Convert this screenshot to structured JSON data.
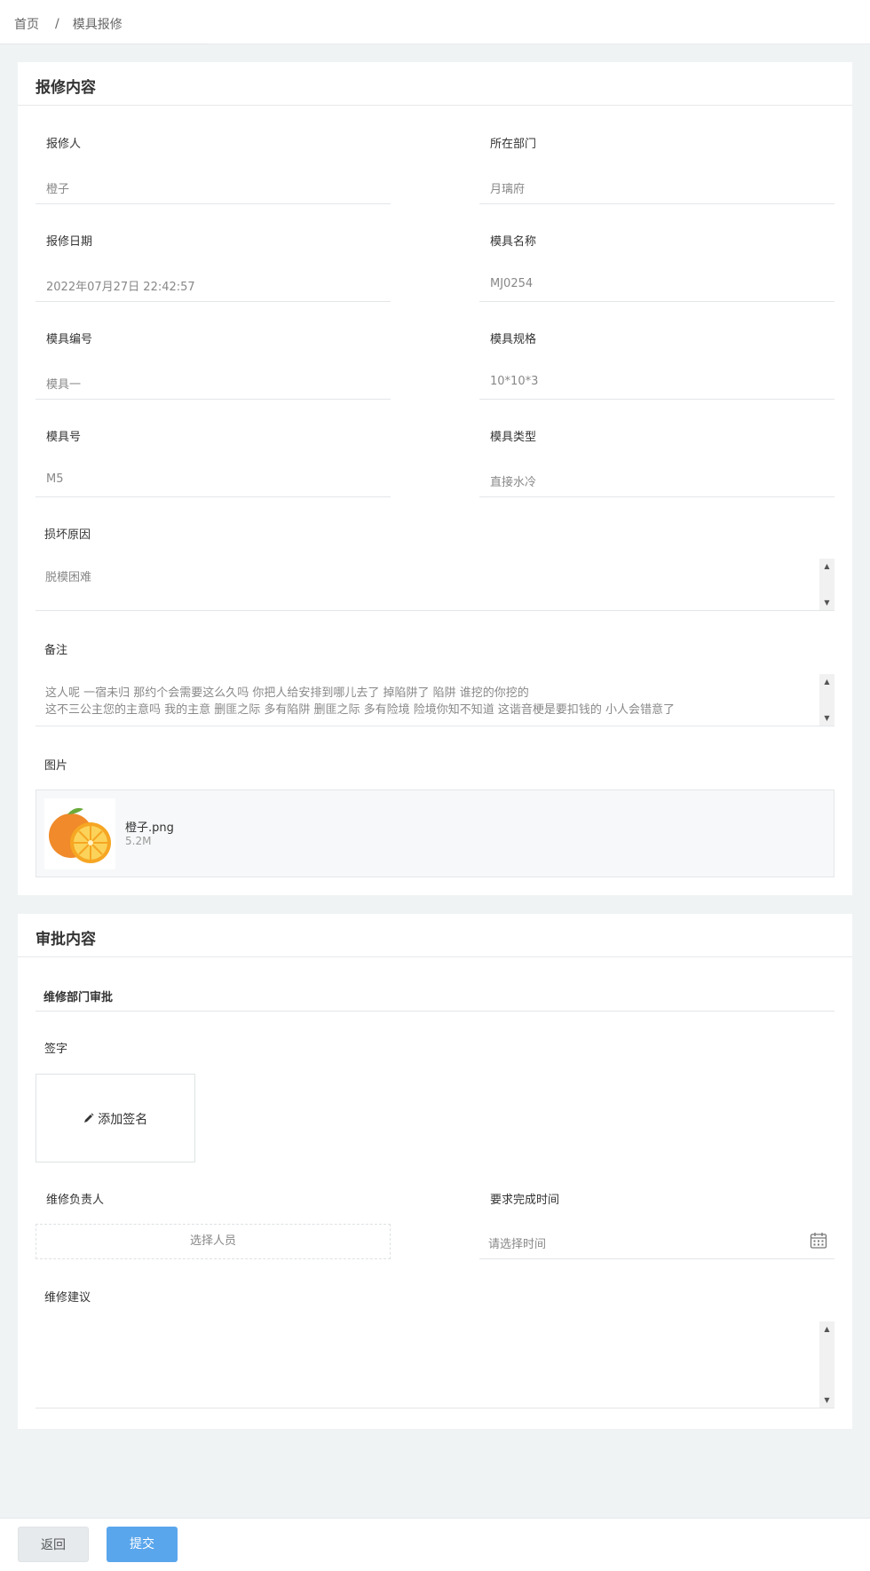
{
  "breadcrumb": {
    "home": "首页",
    "separator": "/",
    "current": "模具报修"
  },
  "repair": {
    "title": "报修内容",
    "fields": {
      "reporter": {
        "label": "报修人",
        "value": "橙子"
      },
      "department": {
        "label": "所在部门",
        "value": "月璃府"
      },
      "date": {
        "label": "报修日期",
        "value": "2022年07月27日 22:42:57"
      },
      "mold_name": {
        "label": "模具名称",
        "value": "MJ0254"
      },
      "mold_code": {
        "label": "模具编号",
        "value": "模具一"
      },
      "mold_spec": {
        "label": "模具规格",
        "value": "10*10*3"
      },
      "mold_no": {
        "label": "模具号",
        "value": "M5"
      },
      "mold_type": {
        "label": "模具类型",
        "value": "直接水冷"
      }
    },
    "damage": {
      "label": "损坏原因",
      "value": "脱模困难"
    },
    "remark": {
      "label": "备注",
      "line1": "这人呢 一宿未归 那约个会需要这么久吗 你把人给安排到哪儿去了 掉陷阱了 陷阱 谁挖的你挖的",
      "line2": "这不三公主您的主意吗 我的主意 删匪之际 多有陷阱 删匪之际 多有险境 险境你知不知道 这谐音梗是要扣钱的 小人会错意了"
    },
    "image": {
      "label": "图片",
      "file_name": "橙子.png",
      "file_size": "5.2M"
    }
  },
  "approval": {
    "title": "审批内容",
    "section": "维修部门审批",
    "signature": {
      "label": "签字",
      "button": "添加签名",
      "icon": "pencil-icon"
    },
    "person": {
      "label": "维修负责人",
      "placeholder": "选择人员"
    },
    "deadline": {
      "label": "要求完成时间",
      "placeholder": "请选择时间",
      "icon": "calendar-icon"
    },
    "advice": {
      "label": "维修建议",
      "value": ""
    }
  },
  "footer": {
    "back": "返回",
    "submit": "提交"
  },
  "colors": {
    "primary": "#5aa6ec",
    "background": "#eff3f4"
  }
}
